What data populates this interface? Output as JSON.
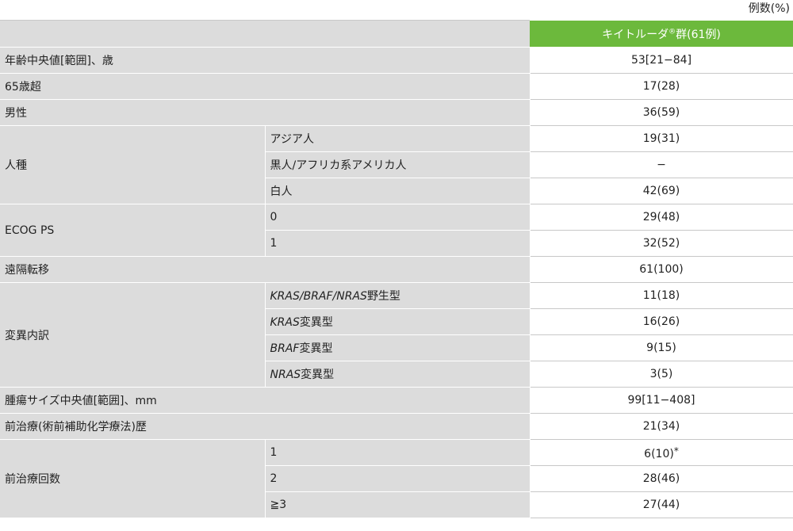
{
  "unit_label": "例数(%)",
  "header": {
    "group_label": "キイトルーダ",
    "group_mark": "®",
    "group_suffix": "群(61例)"
  },
  "rows": {
    "age": {
      "label": "年齢中央値[範囲]、歳",
      "value": "53[21−84]"
    },
    "over65": {
      "label": "65歳超",
      "value": "17(28)"
    },
    "male": {
      "label": "男性",
      "value": "36(59)"
    },
    "race": {
      "label": "人種",
      "items": [
        {
          "label": "アジア人",
          "value": "19(31)"
        },
        {
          "label": "黒人/アフリカ系アメリカ人",
          "value": "−"
        },
        {
          "label": "白人",
          "value": "42(69)"
        }
      ]
    },
    "ecog": {
      "label": "ECOG PS",
      "items": [
        {
          "label": "0",
          "value": "29(48)"
        },
        {
          "label": "1",
          "value": "32(52)"
        }
      ]
    },
    "metastasis": {
      "label": "遠隔転移",
      "value": "61(100)"
    },
    "mutation": {
      "label": "変異内訳",
      "items": [
        {
          "italic": "KRAS/BRAF/NRAS",
          "suffix": "野生型",
          "value": "11(18)"
        },
        {
          "italic": "KRAS",
          "suffix": "変異型",
          "value": "16(26)"
        },
        {
          "italic": "BRAF",
          "suffix": "変異型",
          "value": "9(15)"
        },
        {
          "italic": "NRAS",
          "suffix": "変異型",
          "value": "3(5)"
        }
      ]
    },
    "tumor": {
      "label": "腫瘍サイズ中央値[範囲]、mm",
      "value": "99[11−408]"
    },
    "prior": {
      "label": "前治療(術前補助化学療法)歴",
      "value": "21(34)"
    },
    "prior_count": {
      "label": "前治療回数",
      "items": [
        {
          "label": "1",
          "value": "6(10)",
          "note": "*"
        },
        {
          "label": "2",
          "value": "28(46)"
        },
        {
          "label": "≧3",
          "value": "27(44)"
        }
      ]
    }
  }
}
